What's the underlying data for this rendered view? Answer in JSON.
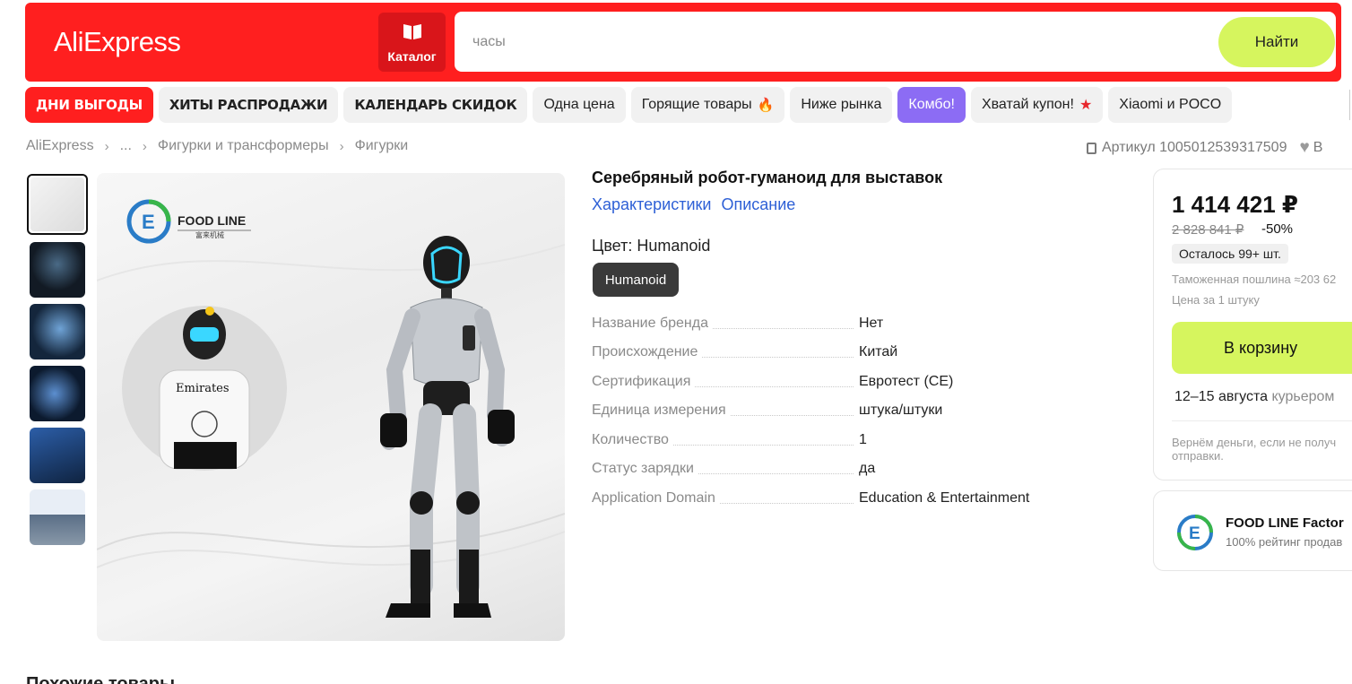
{
  "header": {
    "logo": "AliExpress",
    "catalog_label": "Каталог",
    "search": {
      "value": "",
      "placeholder": "часы",
      "button_label": "Найти"
    }
  },
  "promo_pills": [
    {
      "label": "ДНИ ВЫГОДЫ",
      "style": "red"
    },
    {
      "label": "ХИТЫ РАСПРОДАЖИ",
      "style": "bold"
    },
    {
      "label": "КАЛЕНДАРЬ СКИДОК",
      "style": "bold"
    },
    {
      "label": "Одна цена",
      "style": "plain"
    },
    {
      "label": "Горящие товары",
      "style": "plain",
      "icon": "fire-icon"
    },
    {
      "label": "Ниже рынка",
      "style": "plain"
    },
    {
      "label": "Комбо!",
      "style": "violet"
    },
    {
      "label": "Хватай купон!",
      "style": "plain",
      "icon": "star-icon"
    },
    {
      "label": "Xiaomi и POCO",
      "style": "plain"
    }
  ],
  "breadcrumb": [
    "AliExpress",
    "...",
    "Фигурки и трансформеры",
    "Фигурки"
  ],
  "article": {
    "label": "Артикул 1005012539317509",
    "wishlist_partial": "В"
  },
  "gallery": {
    "thumbnail_count": 6,
    "selected_index": 0,
    "image_brand": {
      "name": "FOOD LINE",
      "sub": "富来机械"
    },
    "image_jersey_text": "Emirates"
  },
  "product": {
    "title": "Серебряный робот-гуманоид для выставок",
    "links": [
      "Характеристики",
      "Описание"
    ],
    "color_label": "Цвет: Humanoid",
    "variant": "Humanoid",
    "specs": [
      {
        "key": "Название бренда",
        "value": "Нет"
      },
      {
        "key": "Происхождение",
        "value": "Китай"
      },
      {
        "key": "Сертификация",
        "value": "Евротест (CE)"
      },
      {
        "key": "Единица измерения",
        "value": "штука/штуки"
      },
      {
        "key": "Количество",
        "value": "1"
      },
      {
        "key": "Статус зарядки",
        "value": "да"
      },
      {
        "key": "Application Domain",
        "value": "Education & Entertainment"
      }
    ]
  },
  "price_card": {
    "price": "1 414 421 ₽",
    "old_price": "2 828 841 ₽",
    "discount": "-50%",
    "stock": "Осталось 99+ шт.",
    "customs_duty": "Таможенная пошлина ≈203 62",
    "unit_price": "Цена за 1 штуку",
    "cart_button": "В корзину",
    "delivery_dates": "12–15 августа",
    "delivery_method": "курьером",
    "refund_text": "Вернём деньги, если не получ отправки."
  },
  "seller": {
    "name": "FOOD LINE Factor",
    "rating": "100% рейтинг продав"
  },
  "section_title": "Похожие товары",
  "colors": {
    "header_red": "#ff1f1f",
    "accent_lime": "#d6f55e",
    "link_blue": "#2e60d6",
    "combo_violet": "#8c6cf4"
  }
}
